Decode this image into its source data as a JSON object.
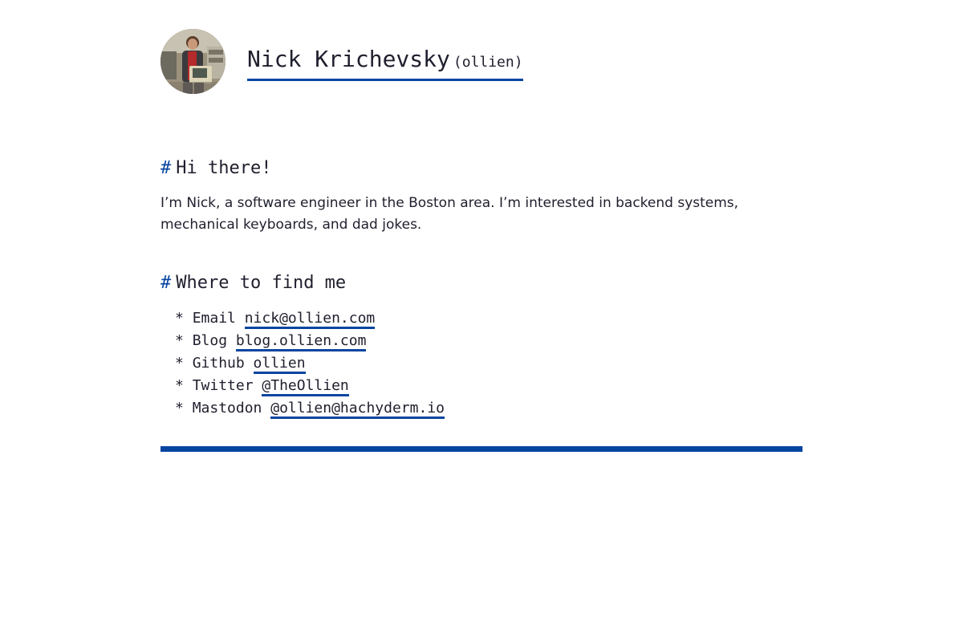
{
  "header": {
    "name": "Nick Krichevsky",
    "handle": "(ollien)"
  },
  "intro_section": {
    "hash": "#",
    "heading": "Hi there!",
    "text": "I’m Nick, a software engineer in the Boston area. I’m interested in backend systems, mechanical keyboards, and dad jokes."
  },
  "find_section": {
    "hash": "#",
    "heading": "Where to find me",
    "links": [
      {
        "bullet": "* ",
        "label": "Email ",
        "value": "nick@ollien.com"
      },
      {
        "bullet": "* ",
        "label": "Blog ",
        "value": "blog.ollien.com"
      },
      {
        "bullet": "* ",
        "label": "Github ",
        "value": "ollien"
      },
      {
        "bullet": "* ",
        "label": "Twitter ",
        "value": "@TheOllien"
      },
      {
        "bullet": "* ",
        "label": "Mastodon ",
        "value": "@ollien@hachyderm.io"
      }
    ]
  },
  "colors": {
    "accent": "#0645a0",
    "text": "#1f1f2e",
    "background": "#ffffff"
  }
}
